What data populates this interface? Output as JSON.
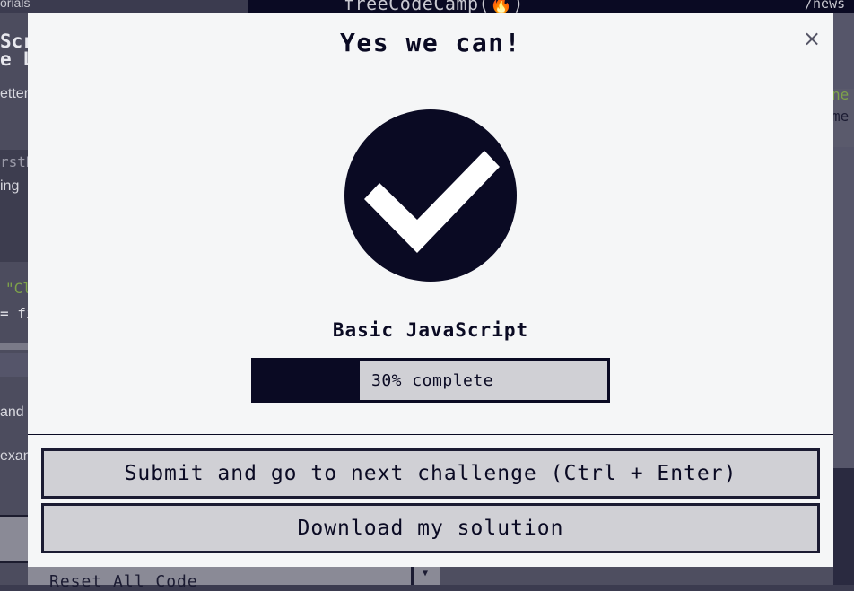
{
  "background": {
    "tab_text": "orials",
    "logo_text": "freeCodeCamp(🔥)",
    "nav_text": "/news",
    "left_fragments": [
      "Scr",
      "e L",
      "etter",
      "rstN",
      "ing",
      "\"Cl",
      "= fi",
      "and t",
      "exan"
    ],
    "right_fragments": [
      "ne",
      "me"
    ],
    "reset_label": "Reset All Code"
  },
  "modal": {
    "title": "Yes we can!",
    "close_label": "×",
    "superblock": "Basic JavaScript",
    "progress": {
      "percent": 30,
      "text": "30% complete"
    },
    "submit_label": "Submit and go to next challenge (Ctrl + Enter)",
    "download_label": "Download my solution"
  },
  "colors": {
    "dark": "#0a0a23",
    "light": "#f5f6f7",
    "button": "#d0d0d5"
  },
  "icons": {
    "close": "close-icon",
    "success": "checkmark-icon"
  }
}
